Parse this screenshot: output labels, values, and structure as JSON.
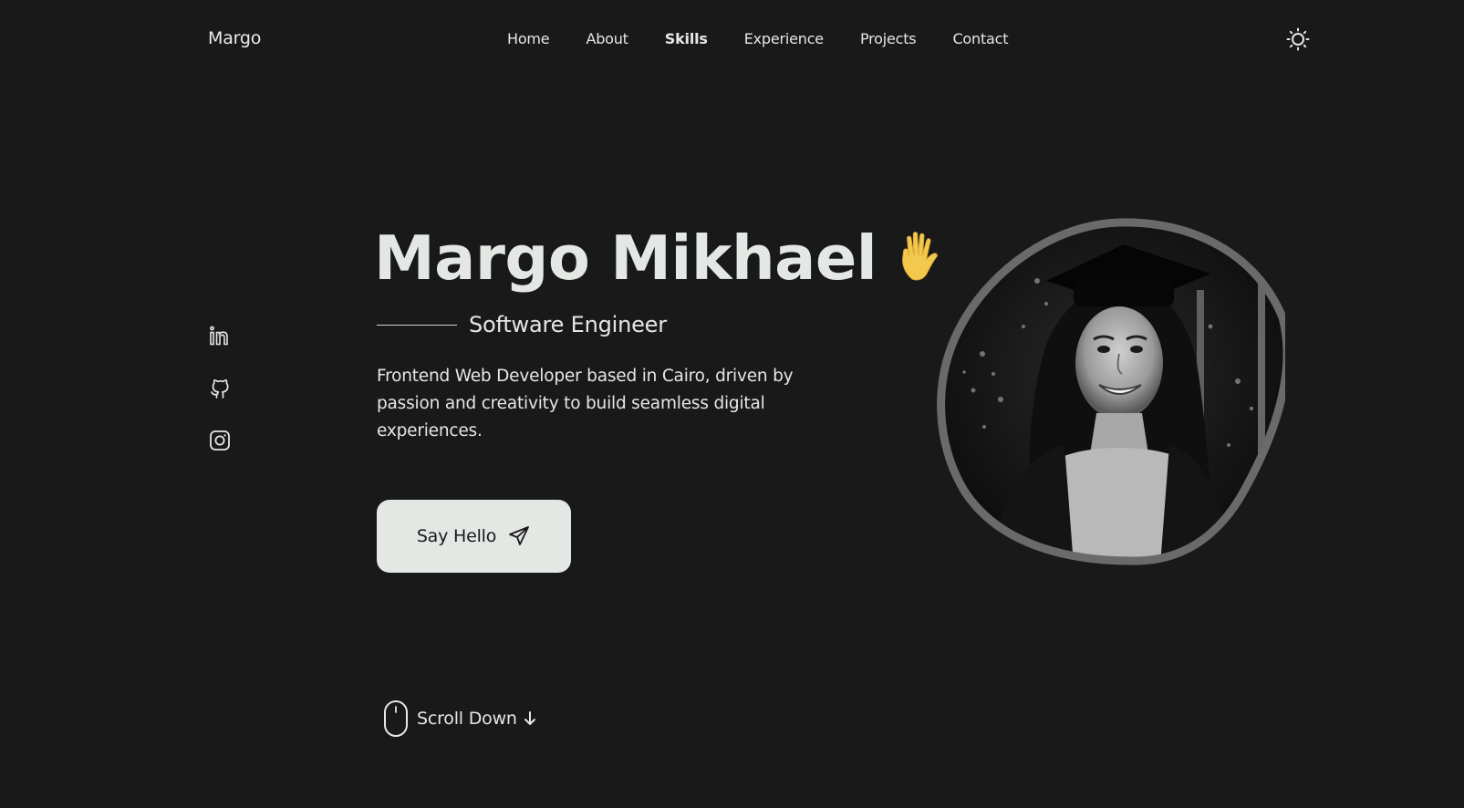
{
  "header": {
    "logo": "Margo",
    "nav": [
      {
        "label": "Home",
        "active": false
      },
      {
        "label": "About",
        "active": false
      },
      {
        "label": "Skills",
        "active": true
      },
      {
        "label": "Experience",
        "active": false
      },
      {
        "label": "Projects",
        "active": false
      },
      {
        "label": "Contact",
        "active": false
      }
    ],
    "theme_icon": "sun-icon"
  },
  "social": [
    {
      "name": "linkedin-icon"
    },
    {
      "name": "github-icon"
    },
    {
      "name": "instagram-icon"
    }
  ],
  "hero": {
    "name": "Margo Mikhael",
    "wave_icon": "raised-hand-emoji",
    "subtitle": "Software Engineer",
    "description": "Frontend Web Developer based in Cairo, driven by passion and creativity to build seamless digital experiences.",
    "cta_label": "Say Hello",
    "cta_icon": "send-icon",
    "scroll_label": "Scroll Down",
    "portrait": "profile-photo"
  },
  "colors": {
    "background": "#191919",
    "text": "#e4e8e4",
    "button_bg": "#e4e8e4",
    "button_text": "#191919",
    "accent_emoji": "#f2c94c"
  }
}
